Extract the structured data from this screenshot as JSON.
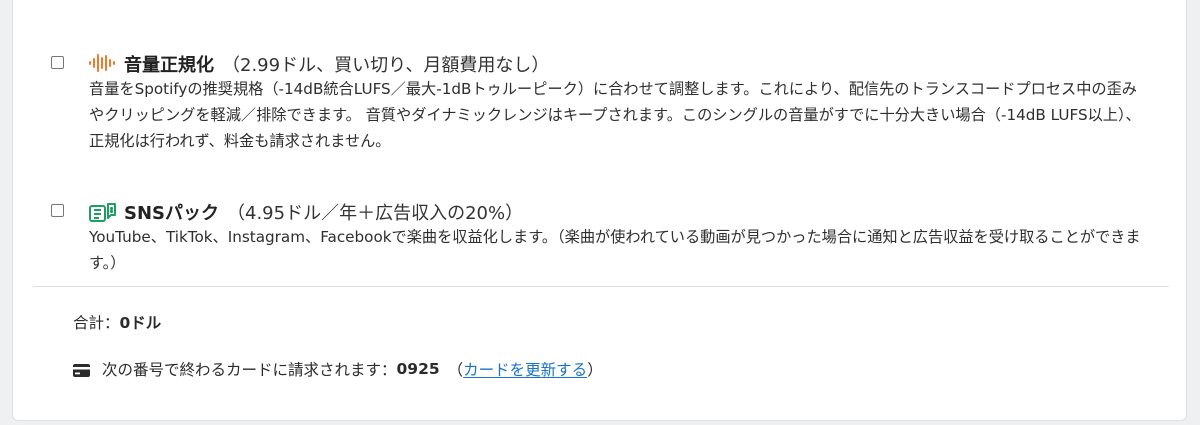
{
  "options": [
    {
      "icon": "sound-waveform-icon",
      "icon_color": "#f07a2a",
      "name": "音量正規化",
      "price": "（2.99ドル、買い切り、月額費用なし）",
      "description": "音量をSpotifyの推奨規格（-14dB統合LUFS／最大-1dBトゥルーピーク）に合わせて調整します。これにより、配信先のトランスコードプロセス中の歪みやクリッピングを軽減／排除できます。 音質やダイナミックレンジはキープされます。このシングルの音量がすでに十分大きい場合（-14dB LUFS以上）、正規化は行われず、料金も請求されません。",
      "checked": false
    },
    {
      "icon": "sns-money-icon",
      "icon_color": "#1e9e60",
      "name": "SNSパック",
      "price": "（4.95ドル／年＋広告収入の20%）",
      "description": "YouTube、TikTok、Instagram、Facebookで楽曲を収益化します。（楽曲が使われている動画が見つかった場合に通知と広告収益を受け取ることができます。）",
      "checked": false
    }
  ],
  "total": {
    "label": "合計：",
    "amount": "0ドル"
  },
  "billing": {
    "icon": "credit-card-icon",
    "text": "次の番号で終わるカードに請求されます：",
    "last4": "0925",
    "open_paren": "（",
    "link": "カードを更新する",
    "close_paren": "）"
  },
  "colors": {
    "link": "#1a73c8",
    "divider": "#dcdfe2"
  }
}
